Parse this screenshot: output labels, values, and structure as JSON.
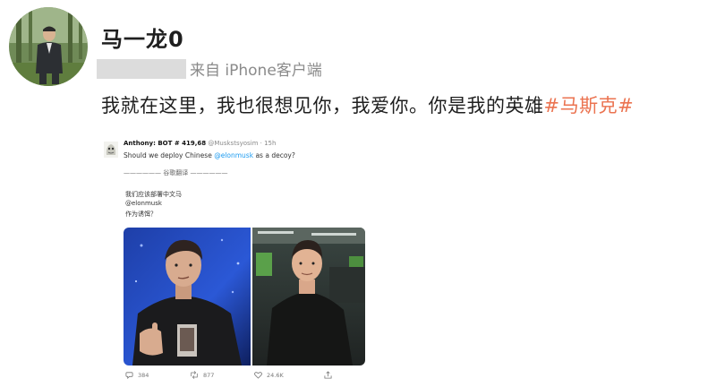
{
  "post": {
    "username": "马一龙0",
    "source_prefix": "来自 iPhone客户端",
    "text_main": "我就在这里，我也很想见你，我爱你。你是我的英雄",
    "hashtag": "#马斯克#"
  },
  "tweet": {
    "display_name": "Anthony: BOT # 419,68",
    "handle_time": "@Muskstsyosim · 15h",
    "text_before": "Should we deploy Chinese ",
    "mention": "@elonmusk",
    "text_after": " as a decoy?",
    "translate_label": "—————— 谷歌翻译 ——————",
    "cn_line1": "我们应该部署中文马",
    "cn_line2": "@elonmusk",
    "cn_line3": "作为诱饵？",
    "replies": "384",
    "retweets": "877",
    "likes": "24.6K"
  },
  "colors": {
    "hashtag": "#eb7350",
    "link": "#1d9bf0",
    "username": "#1f1f1f",
    "meta": "#8a8a8a"
  },
  "icons": [
    "reply-icon",
    "retweet-icon",
    "like-icon",
    "share-icon"
  ]
}
